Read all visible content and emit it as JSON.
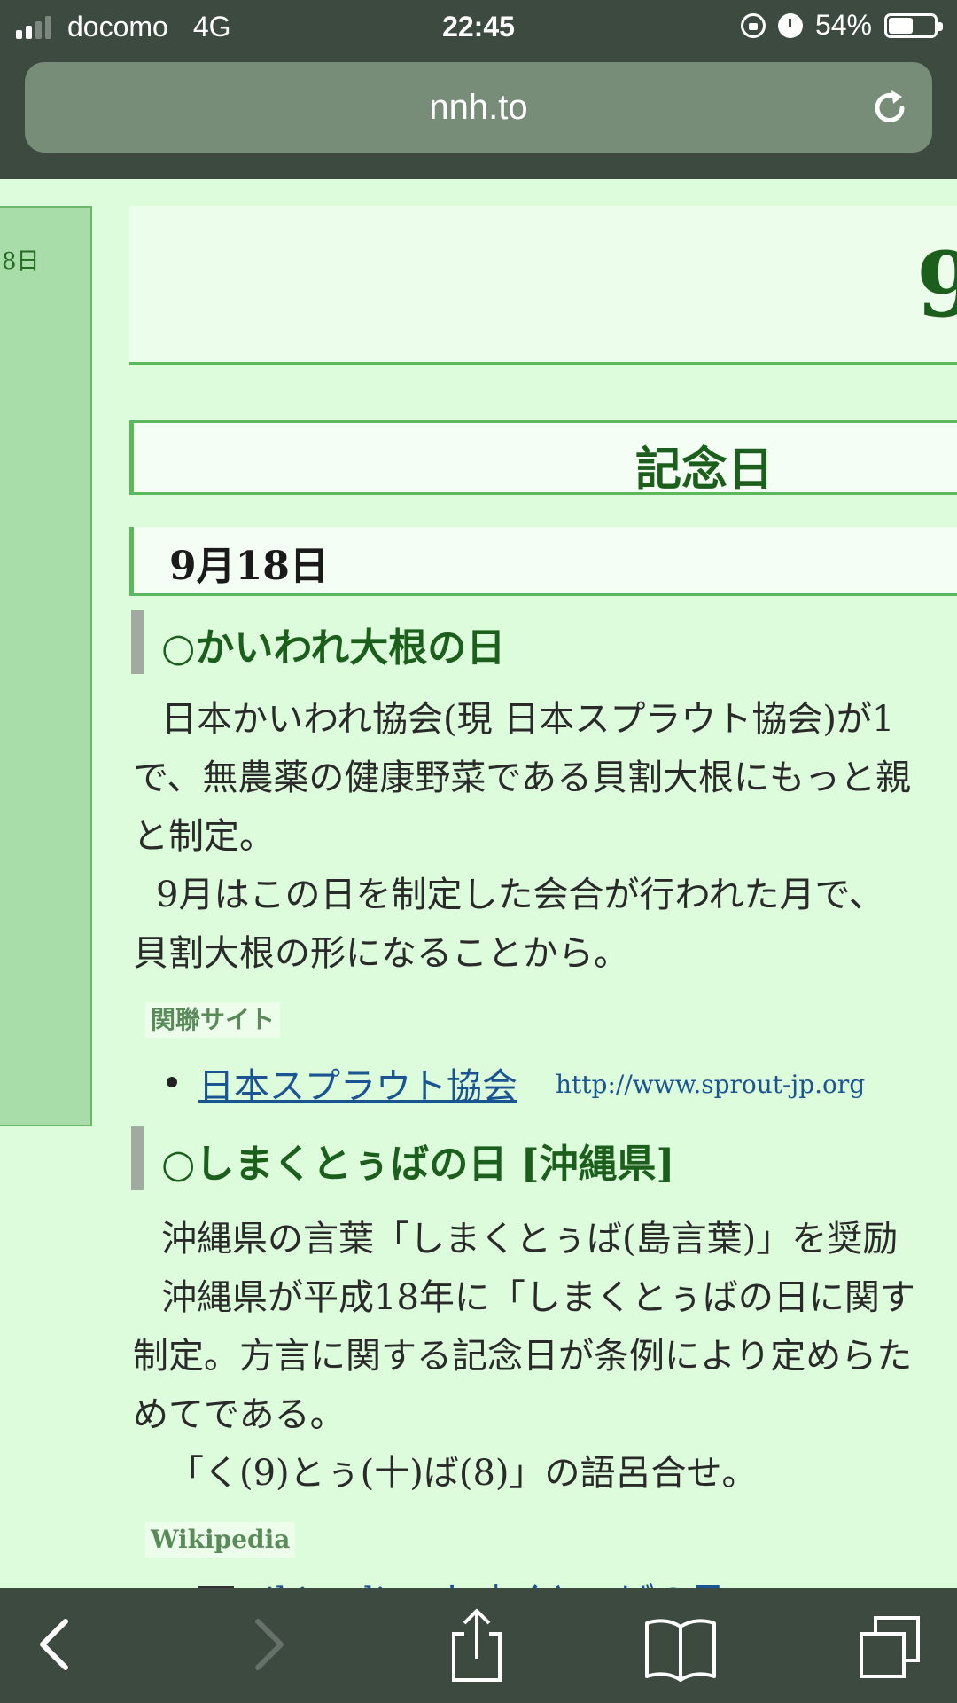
{
  "status": {
    "carrier": "docomo",
    "network": "4G",
    "time": "22:45",
    "battery": "54%",
    "battery_level": 0.54
  },
  "browser": {
    "url": "nnh.to"
  },
  "sidebar": {
    "date_fragment": "8日"
  },
  "page": {
    "top_fragment": "9",
    "section_title": "記念日",
    "date_heading": "9月18日",
    "entries": [
      {
        "title": "○かいわれ大根の日",
        "lines": [
          "日本かいわれ協会(現 日本スプラウト協会)が1",
          "で、無農薬の健康野菜である貝割大根にもっと親",
          "と制定。",
          "9月はこの日を制定した会合が行われた月で、",
          "貝割大根の形になることから。"
        ],
        "tag": "関聯サイト",
        "link_text": "日本スプラウト協会",
        "link_url": "http://www.sprout-jp.org"
      },
      {
        "title": "○しまくとぅばの日 [沖縄県]",
        "lines": [
          "沖縄県の言葉「しまくとぅば(島言葉)」を奨励",
          "沖縄県が平成18年に「しまくとぅばの日に関す",
          "制定。方言に関する記念日が条例により定めらた",
          "めてである。",
          "「く(9)とぅ(十)ば(8)」の語呂合せ。"
        ],
        "tag": "Wikipedia",
        "link_text": "wikipedia - しまくとぅばの日",
        "link_icon_letter": "W"
      }
    ]
  },
  "toolbar": {
    "back": "chevron-left-icon",
    "forward": "chevron-right-icon",
    "share": "share-icon",
    "bookmarks": "book-icon",
    "tabs": "tabs-icon"
  },
  "colors": {
    "page_bg": "#dcfcdc",
    "accent_green": "#5cb85c",
    "heading_green": "#1c5f1c",
    "chrome": "#3d4a3f",
    "url_field": "#788d78",
    "link": "#1b5591"
  }
}
